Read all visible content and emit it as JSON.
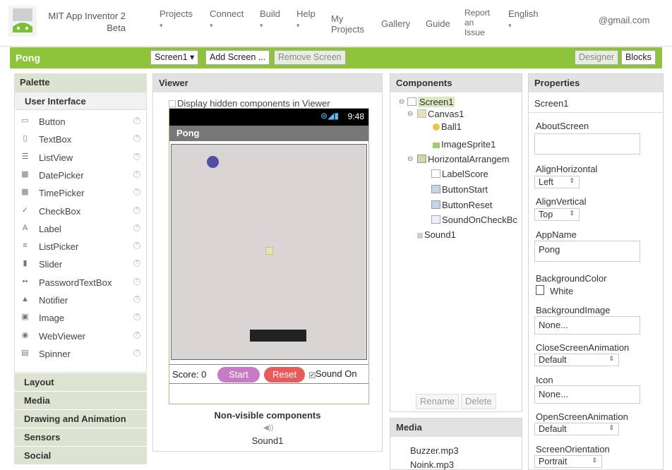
{
  "app": {
    "title": "MIT App Inventor 2",
    "subtitle": "Beta"
  },
  "nav": {
    "projects": "Projects",
    "connect": "Connect",
    "build": "Build",
    "help": "Help",
    "my_projects_1": "My",
    "my_projects_2": "Projects",
    "gallery": "Gallery",
    "guide": "Guide",
    "report_1": "Report",
    "report_2": "an",
    "report_3": "Issue",
    "language": "English",
    "account": "@gmail.com",
    "caret": "▾"
  },
  "toolbar": {
    "project_name": "Pong",
    "screen_select": "Screen1 ▾",
    "add_screen": "Add Screen ...",
    "remove_screen": "Remove Screen",
    "designer": "Designer",
    "blocks": "Blocks"
  },
  "palette": {
    "title": "Palette",
    "open_category": "User Interface",
    "items": [
      {
        "label": "Button",
        "icon": "button-icon",
        "glyph": "▭"
      },
      {
        "label": "TextBox",
        "icon": "textbox-icon",
        "glyph": "▯"
      },
      {
        "label": "ListView",
        "icon": "listview-icon",
        "glyph": "☰"
      },
      {
        "label": "DatePicker",
        "icon": "datepicker-icon",
        "glyph": "▦"
      },
      {
        "label": "TimePicker",
        "icon": "timepicker-icon",
        "glyph": "▦"
      },
      {
        "label": "CheckBox",
        "icon": "checkbox-icon",
        "glyph": "✓"
      },
      {
        "label": "Label",
        "icon": "label-icon",
        "glyph": "A"
      },
      {
        "label": "ListPicker",
        "icon": "listpicker-icon",
        "glyph": "≡"
      },
      {
        "label": "Slider",
        "icon": "slider-icon",
        "glyph": "▮"
      },
      {
        "label": "PasswordTextBox",
        "icon": "password-icon",
        "glyph": "••"
      },
      {
        "label": "Notifier",
        "icon": "notifier-icon",
        "glyph": "▲"
      },
      {
        "label": "Image",
        "icon": "image-icon",
        "glyph": "▣"
      },
      {
        "label": "WebViewer",
        "icon": "webviewer-icon",
        "glyph": "◉"
      },
      {
        "label": "Spinner",
        "icon": "spinner-icon",
        "glyph": "▤"
      }
    ],
    "help_glyph": "?",
    "categories": [
      "Layout",
      "Media",
      "Drawing and Animation",
      "Sensors",
      "Social"
    ]
  },
  "viewer": {
    "title": "Viewer",
    "display_hidden": "Display hidden components in Viewer",
    "status_time": "9:48",
    "status_icons": "⊚◢▮",
    "screen_title": "Pong",
    "score": "Score: 0",
    "start": "Start",
    "reset": "Reset",
    "sound_on": "Sound On",
    "check_glyph": "✓",
    "nonvisible_label": "Non-visible components",
    "nonvisible_icon": "◀))",
    "nonvisible_item": "Sound1"
  },
  "components": {
    "title": "Components",
    "tree": {
      "screen1": "Screen1",
      "canvas1": "Canvas1",
      "ball1": "Ball1",
      "imagesprite1": "ImageSprite1",
      "horizontal": "HorizontalArrangem",
      "labelscore": "LabelScore",
      "buttonstart": "ButtonStart",
      "buttonreset": "ButtonReset",
      "soundoncheck": "SoundOnCheckBc",
      "sound1": "Sound1"
    },
    "toggle": "⊖",
    "rename": "Rename",
    "delete": "Delete"
  },
  "media": {
    "title": "Media",
    "files": [
      "Buzzer.mp3",
      "Noink.mp3"
    ]
  },
  "properties": {
    "title": "Properties",
    "selected": "Screen1",
    "about_screen_label": "AboutScreen",
    "about_screen_value": "",
    "align_horizontal_label": "AlignHorizontal",
    "align_horizontal_value": "Left",
    "align_vertical_label": "AlignVertical",
    "align_vertical_value": "Top",
    "app_name_label": "AppName",
    "app_name_value": "Pong",
    "bg_color_label": "BackgroundColor",
    "bg_color_value": "White",
    "bg_image_label": "BackgroundImage",
    "bg_image_value": "None...",
    "close_anim_label": "CloseScreenAnimation",
    "close_anim_value": "Default",
    "icon_label": "Icon",
    "icon_value": "None...",
    "open_anim_label": "OpenScreenAnimation",
    "open_anim_value": "Default",
    "orientation_label": "ScreenOrientation",
    "orientation_value": "Portrait",
    "select_arrow": "⇕"
  },
  "colors": {
    "accent_green": "#8dc43a",
    "start_button": "#c77bc6",
    "reset_button": "#e85b5b",
    "ball": "#4f4fa6",
    "canvas_bg": "#d8d5d4"
  }
}
